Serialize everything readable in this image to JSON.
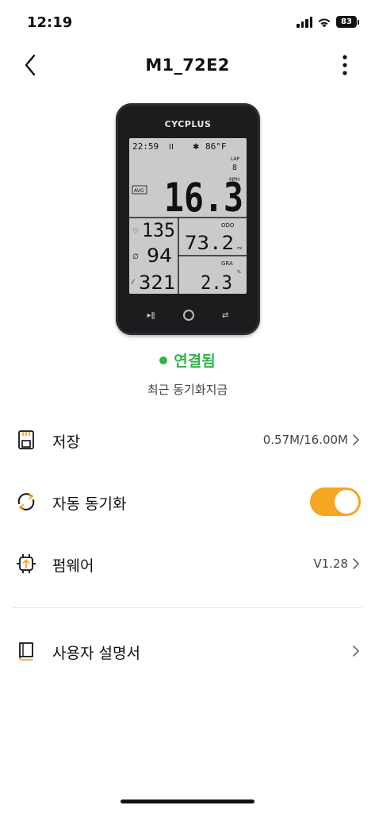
{
  "status_bar": {
    "time": "12:19",
    "battery": "83",
    "icons": [
      "cellular-signal-icon",
      "wifi-icon",
      "battery-icon"
    ]
  },
  "header": {
    "title": "M1_72E2",
    "back_icon": "chevron-left-icon",
    "more_icon": "more-vertical-icon"
  },
  "device": {
    "brand": "CYCPLUS",
    "screen": {
      "clock": "22:59",
      "temperature": "86°F",
      "lap_label": "LAP",
      "lap_value": "8",
      "avg_label": "AVG",
      "speed": "16.3",
      "speed_unit": "MPH",
      "heart_rate": "135",
      "cadence": "94",
      "altitude": "321",
      "odo_label": "ODO",
      "odo_value": "73.2",
      "odo_unit": "mi",
      "gra_label": "GRA",
      "gra_value": "2.3",
      "gra_unit": "%"
    }
  },
  "connection": {
    "status": "연결됨",
    "last_sync": "최근 동기화지금",
    "status_color": "#33b24a"
  },
  "menu": {
    "storage": {
      "label": "저장",
      "value": "0.57M/16.00M",
      "icon": "storage-icon"
    },
    "auto_sync": {
      "label": "자동 동기화",
      "enabled": true,
      "icon": "sync-icon"
    },
    "firmware": {
      "label": "펌웨어",
      "value": "V1.28",
      "icon": "firmware-icon"
    },
    "manual": {
      "label": "사용자 설명서",
      "icon": "book-icon"
    }
  },
  "colors": {
    "accent": "#f5a623",
    "connected": "#33b24a"
  }
}
